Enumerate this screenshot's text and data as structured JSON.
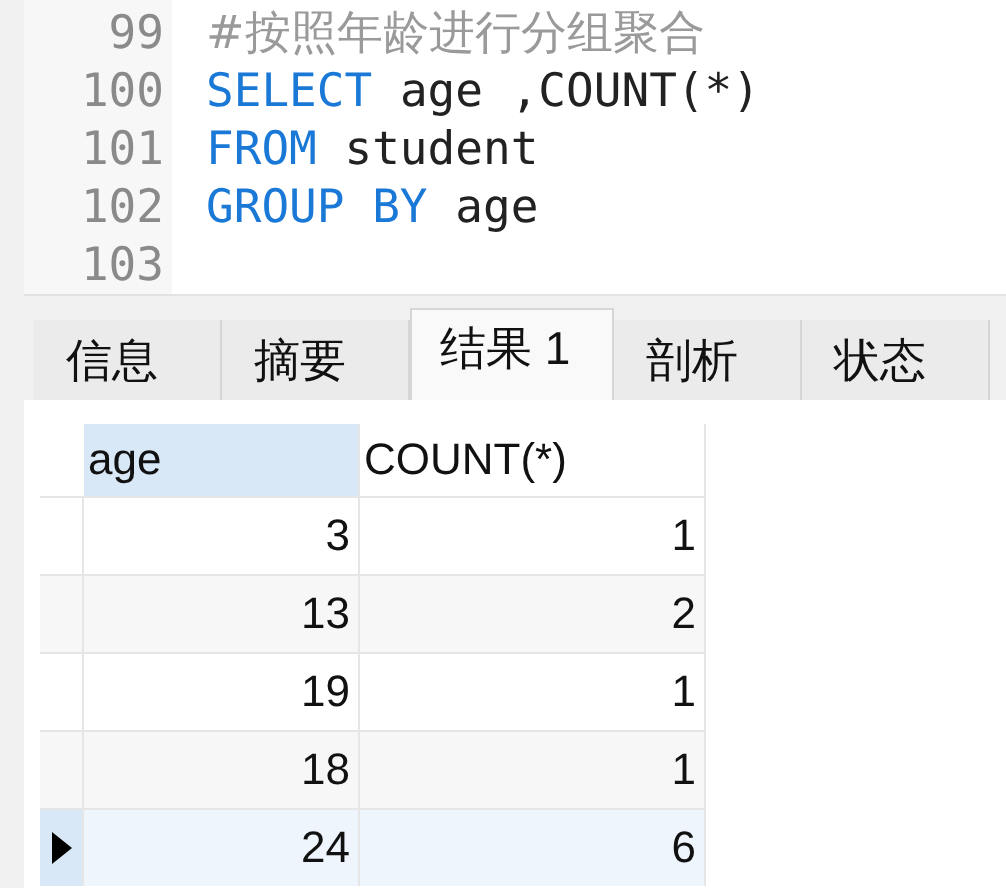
{
  "editor": {
    "lines": [
      {
        "number": "99",
        "tokens": [
          {
            "kind": "comment",
            "text": "#按照年龄进行分组聚合"
          }
        ]
      },
      {
        "number": "100",
        "tokens": [
          {
            "kind": "keyword",
            "text": "SELECT"
          },
          {
            "kind": "plain",
            "text": " age ,COUNT(*)"
          }
        ]
      },
      {
        "number": "101",
        "tokens": [
          {
            "kind": "keyword",
            "text": "FROM"
          },
          {
            "kind": "plain",
            "text": " student"
          }
        ]
      },
      {
        "number": "102",
        "tokens": [
          {
            "kind": "keyword",
            "text": "GROUP BY"
          },
          {
            "kind": "plain",
            "text": " age"
          }
        ]
      },
      {
        "number": "103"
      }
    ]
  },
  "tabs": [
    {
      "label": "信息",
      "selected": false
    },
    {
      "label": "摘要",
      "selected": false
    },
    {
      "label": "结果 1",
      "selected": true
    },
    {
      "label": "剖析",
      "selected": false
    },
    {
      "label": "状态",
      "selected": false
    }
  ],
  "table": {
    "columns": [
      {
        "label": "age",
        "selected": true
      },
      {
        "label": "COUNT(*)",
        "selected": false
      }
    ],
    "rows": [
      {
        "cells": [
          "3",
          "1"
        ],
        "selected": false
      },
      {
        "cells": [
          "13",
          "2"
        ],
        "selected": false
      },
      {
        "cells": [
          "19",
          "1"
        ],
        "selected": false
      },
      {
        "cells": [
          "18",
          "1"
        ],
        "selected": false
      },
      {
        "cells": [
          "24",
          "6"
        ],
        "selected": true
      }
    ]
  }
}
